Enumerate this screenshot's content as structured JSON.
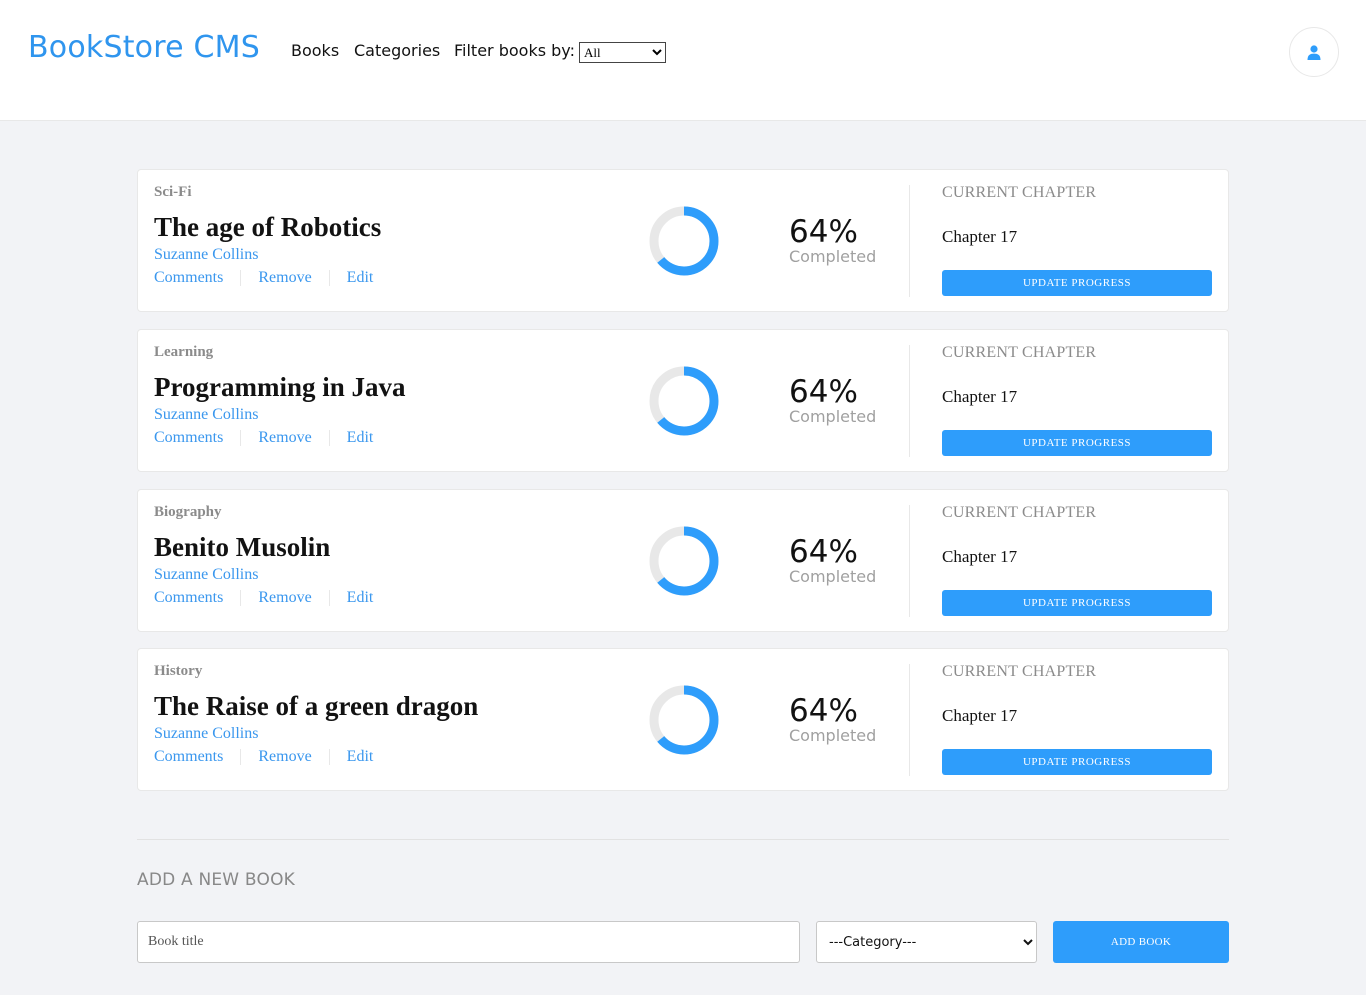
{
  "header": {
    "brand": "BookStore CMS",
    "nav": [
      "Books",
      "Categories"
    ],
    "filter_label": "Filter books by:",
    "filter_value": "All"
  },
  "books": [
    {
      "genre": "Sci-Fi",
      "title": "The age of Robotics",
      "author": "Suzanne Collins",
      "progress_percent": 64,
      "percent_label": "64%",
      "completed_label": "Completed",
      "current_chapter_label": "CURRENT CHAPTER",
      "chapter": "Chapter 17",
      "update_label": "UPDATE PROGRESS"
    },
    {
      "genre": "Learning",
      "title": "Programming in Java",
      "author": "Suzanne Collins",
      "progress_percent": 64,
      "percent_label": "64%",
      "completed_label": "Completed",
      "current_chapter_label": "CURRENT CHAPTER",
      "chapter": "Chapter 17",
      "update_label": "UPDATE PROGRESS"
    },
    {
      "genre": "Biography",
      "title": "Benito Musolin",
      "author": "Suzanne Collins",
      "progress_percent": 64,
      "percent_label": "64%",
      "completed_label": "Completed",
      "current_chapter_label": "CURRENT CHAPTER",
      "chapter": "Chapter 17",
      "update_label": "UPDATE PROGRESS"
    },
    {
      "genre": "History",
      "title": "The Raise of a green dragon",
      "author": "Suzanne Collins",
      "progress_percent": 64,
      "percent_label": "64%",
      "completed_label": "Completed",
      "current_chapter_label": "CURRENT CHAPTER",
      "chapter": "Chapter 17",
      "update_label": "UPDATE PROGRESS"
    }
  ],
  "actions": {
    "comments": "Comments",
    "remove": "Remove",
    "edit": "Edit"
  },
  "add_form": {
    "heading": "ADD A NEW BOOK",
    "title_placeholder": "Book title",
    "category_placeholder": "---Category---",
    "submit_label": "ADD BOOK"
  },
  "icons": {
    "user": "user-icon"
  },
  "colors": {
    "accent": "#2e9dfb",
    "brand": "#2f95ee",
    "ring_track": "#e8e8e8"
  }
}
